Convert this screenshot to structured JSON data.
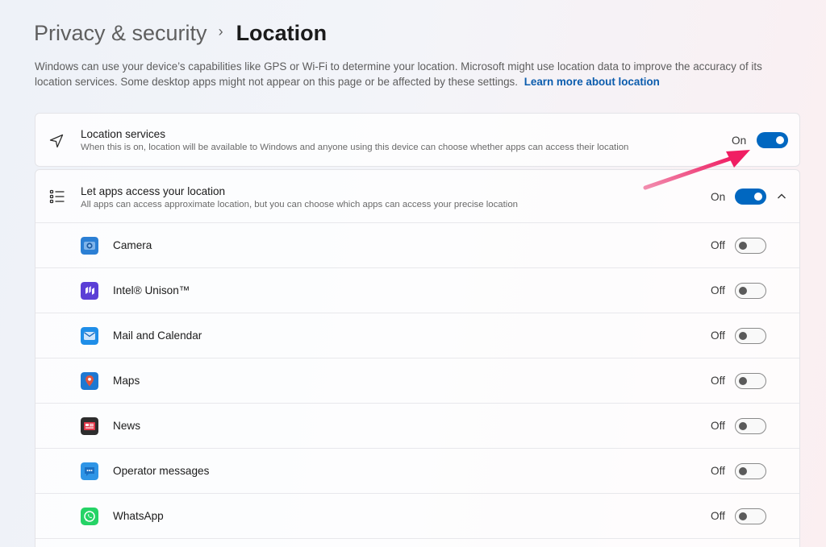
{
  "breadcrumb": {
    "parent": "Privacy & security",
    "separator": "›",
    "current": "Location"
  },
  "description": {
    "text": "Windows can use your device’s capabilities like GPS or Wi-Fi to determine your location. Microsoft might use location data to improve the accuracy of its location services. Some desktop apps might not appear on this page or be affected by these settings.",
    "link": "Learn more about location"
  },
  "location_services": {
    "icon": "navigation-arrow-icon",
    "title": "Location services",
    "subtitle": "When this is on, location will be available to Windows and anyone using this device can choose whether apps can access their location",
    "state": "On",
    "enabled": true
  },
  "apps_access": {
    "icon": "list-icon",
    "title": "Let apps access your location",
    "subtitle": "All apps can access approximate location, but you can choose which apps can access your precise location",
    "state": "On",
    "enabled": true,
    "expanded": true
  },
  "apps": [
    {
      "name": "Camera",
      "state": "Off",
      "enabled": false,
      "icon": "camera-app-icon",
      "color": "#2b7fd4"
    },
    {
      "name": "Intel® Unison™",
      "state": "Off",
      "enabled": false,
      "icon": "intel-unison-app-icon",
      "color": "#5b3fd6"
    },
    {
      "name": "Mail and Calendar",
      "state": "Off",
      "enabled": false,
      "icon": "mail-app-icon",
      "color": "#1f8ee8"
    },
    {
      "name": "Maps",
      "state": "Off",
      "enabled": false,
      "icon": "maps-app-icon",
      "color": "#1e78d2"
    },
    {
      "name": "News",
      "state": "Off",
      "enabled": false,
      "icon": "news-app-icon",
      "color": "#2d2d2d"
    },
    {
      "name": "Operator messages",
      "state": "Off",
      "enabled": false,
      "icon": "operator-messages-app-icon",
      "color": "#2f95e6"
    },
    {
      "name": "WhatsApp",
      "state": "Off",
      "enabled": false,
      "icon": "whatsapp-app-icon",
      "color": "#25d366"
    }
  ],
  "colors": {
    "accent": "#0067c0",
    "link": "#0b5cad",
    "annotation_arrow": "#e8326e"
  }
}
